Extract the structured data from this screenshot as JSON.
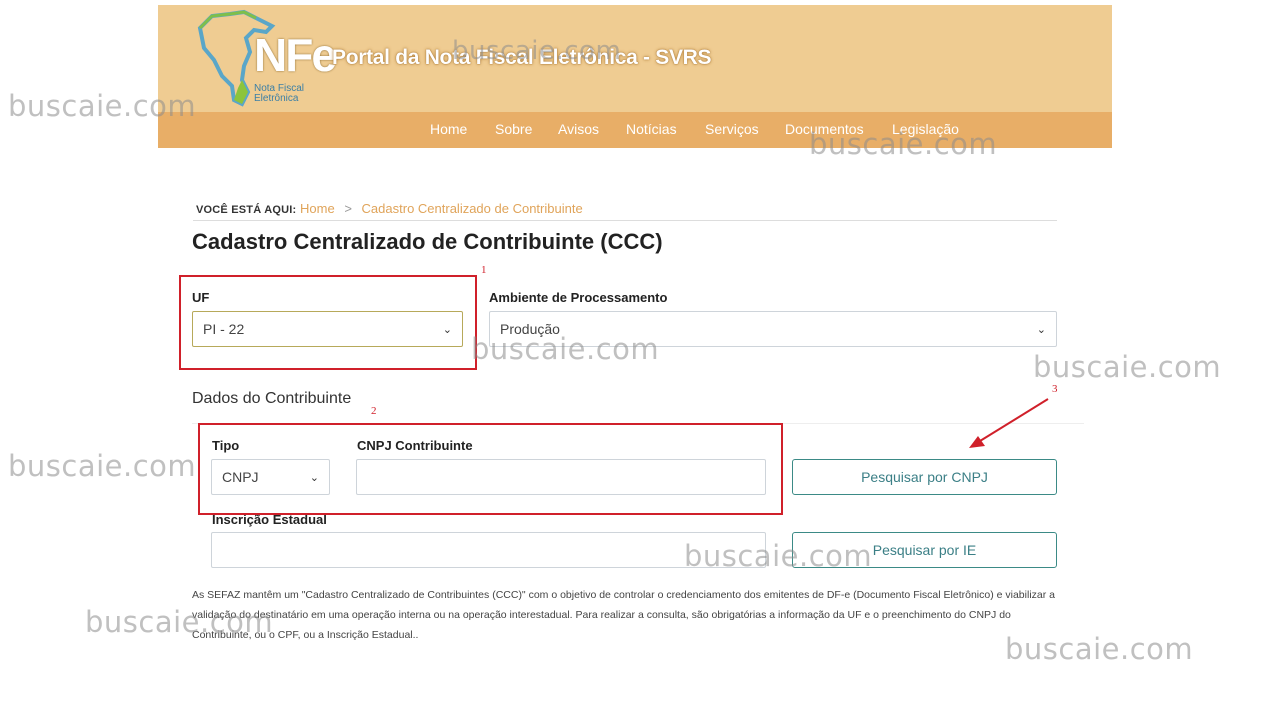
{
  "header": {
    "logo_text": "NFe",
    "logo_sub": "Nota Fiscal Eletrônica",
    "title": "Portal da Nota Fiscal Eletrônica - SVRS",
    "nav": [
      "Home",
      "Sobre",
      "Avisos",
      "Notícias",
      "Serviços",
      "Documentos",
      "Legislação"
    ]
  },
  "breadcrumb": {
    "prefix": "VOCÊ ESTÁ AQUI:",
    "home": "Home",
    "separator": ">",
    "current": "Cadastro Centralizado de Contribuinte"
  },
  "page_title": "Cadastro Centralizado de Contribuinte (CCC)",
  "form": {
    "uf_label": "UF",
    "uf_value": "PI - 22",
    "ambiente_label": "Ambiente de Processamento",
    "ambiente_value": "Produção",
    "section_title": "Dados do Contribuinte",
    "tipo_label": "Tipo",
    "tipo_value": "CNPJ",
    "cnpj_label": "CNPJ Contribuinte",
    "cnpj_value": "",
    "ie_label": "Inscrição Estadual",
    "ie_value": "",
    "btn_cnpj": "Pesquisar por CNPJ",
    "btn_ie": "Pesquisar por IE"
  },
  "description": "As SEFAZ mantêm um \"Cadastro Centralizado de Contribuintes (CCC)\" com o objetivo de controlar o credenciamento dos emitentes de DF-e (Documento Fiscal Eletrônico) e viabilizar a validação do destinatário em uma operação interna ou na operação interestadual. Para realizar a consulta, são obrigatórias a informação da UF e o preenchimento do CNPJ do Contribuinte, ou o CPF, ou a Inscrição Estadual..",
  "annotations": [
    "1",
    "2",
    "3"
  ],
  "watermark": "buscaie.com",
  "colors": {
    "header_bg": "#efcc92",
    "nav_bg": "#e8ae67",
    "link": "#e0a45a",
    "button": "#3b7f86",
    "annotation": "#d0202a"
  }
}
